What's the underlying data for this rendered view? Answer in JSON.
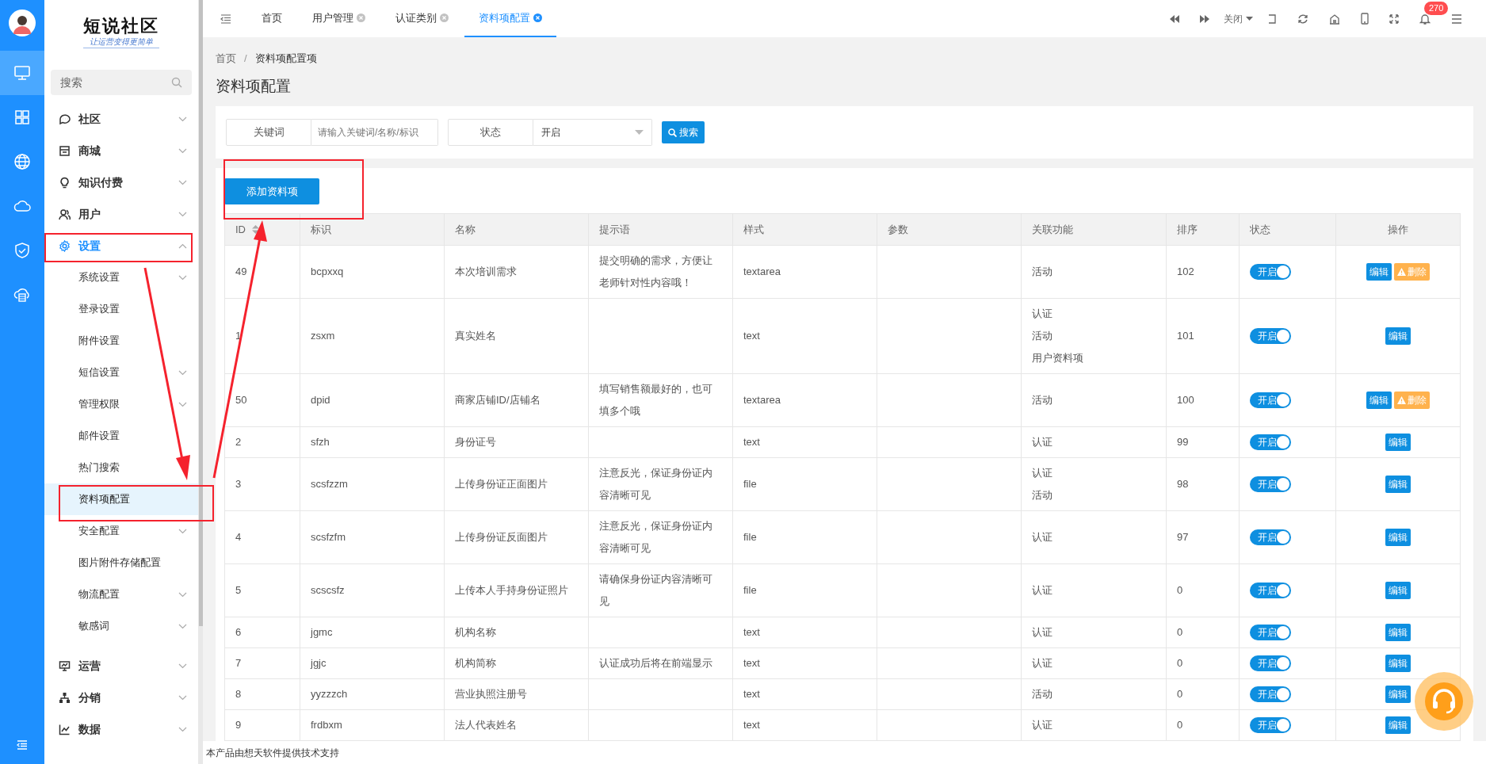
{
  "rail": {
    "items": [
      {
        "selected": true
      },
      {
        "selected": false
      },
      {
        "selected": false
      },
      {
        "selected": false
      },
      {
        "selected": false
      },
      {
        "selected": false
      }
    ]
  },
  "logo": {
    "title": "短说社区",
    "tagline": "让运营变得更简单"
  },
  "sidebar": {
    "search": {
      "placeholder": "搜索"
    },
    "items": [
      {
        "label": "社区",
        "expandable": true,
        "expanded": false,
        "selected": false
      },
      {
        "label": "商城",
        "expandable": true,
        "expanded": false,
        "selected": false
      },
      {
        "label": "知识付费",
        "expandable": true,
        "expanded": false,
        "selected": false
      },
      {
        "label": "用户",
        "expandable": true,
        "expanded": false,
        "selected": false
      },
      {
        "label": "设置",
        "expandable": true,
        "expanded": true,
        "selected": true,
        "children": [
          {
            "label": "系统设置",
            "expandable": true,
            "selected": false
          },
          {
            "label": "登录设置",
            "expandable": false,
            "selected": false
          },
          {
            "label": "附件设置",
            "expandable": false,
            "selected": false
          },
          {
            "label": "短信设置",
            "expandable": true,
            "selected": false
          },
          {
            "label": "管理权限",
            "expandable": true,
            "selected": false
          },
          {
            "label": "邮件设置",
            "expandable": false,
            "selected": false
          },
          {
            "label": "热门搜索",
            "expandable": false,
            "selected": false
          },
          {
            "label": "资料项配置",
            "expandable": false,
            "selected": true
          },
          {
            "label": "安全配置",
            "expandable": true,
            "selected": false
          },
          {
            "label": "图片附件存储配置",
            "expandable": false,
            "selected": false
          },
          {
            "label": "物流配置",
            "expandable": true,
            "selected": false
          },
          {
            "label": "敏感词",
            "expandable": true,
            "selected": false
          }
        ]
      },
      {
        "label": "运营",
        "expandable": true,
        "expanded": false,
        "selected": false
      },
      {
        "label": "分销",
        "expandable": true,
        "expanded": false,
        "selected": false
      },
      {
        "label": "数据",
        "expandable": true,
        "expanded": false,
        "selected": false
      }
    ]
  },
  "tabs": [
    {
      "label": "首页",
      "closable": false,
      "selected": false
    },
    {
      "label": "用户管理",
      "closable": true,
      "selected": false
    },
    {
      "label": "认证类别",
      "closable": true,
      "selected": false
    },
    {
      "label": "资料项配置",
      "closable": true,
      "selected": true
    }
  ],
  "toolbar": {
    "close_menu": "关闭",
    "notification_count": "270"
  },
  "breadcrumb": [
    "首页",
    "资料项配置项"
  ],
  "breadcrumb_separator": "/",
  "page_title": "资料项配置",
  "filters": [
    {
      "kind": "text",
      "label": "关键词",
      "placeholder": "请输入关键词/名称/标识"
    },
    {
      "kind": "select",
      "label": "状态",
      "value": "开启"
    }
  ],
  "search_button": "搜索",
  "add_button": "添加资料项",
  "table": {
    "columns": [
      {
        "label": "ID",
        "sortable": true
      },
      {
        "label": "标识",
        "sortable": false
      },
      {
        "label": "名称",
        "sortable": false
      },
      {
        "label": "提示语",
        "sortable": false
      },
      {
        "label": "样式",
        "sortable": false
      },
      {
        "label": "参数",
        "sortable": false
      },
      {
        "label": "关联功能",
        "sortable": false
      },
      {
        "label": "排序",
        "sortable": false
      },
      {
        "label": "状态",
        "sortable": false
      },
      {
        "label": "操作",
        "sortable": false
      }
    ],
    "rows": [
      {
        "id": "49",
        "key": "bcpxxq",
        "name": "本次培训需求",
        "hint": "提交明确的需求，方便让老师针对性内容哦！",
        "style": "textarea",
        "linked": [
          "活动"
        ],
        "sort": "102",
        "status": {
          "label": "开启",
          "on": true
        },
        "actions": [
          {
            "kind": "edit",
            "label": "编辑"
          },
          {
            "kind": "delete",
            "label": "删除"
          }
        ]
      },
      {
        "id": "1",
        "key": "zsxm",
        "name": "真实姓名",
        "style": "text",
        "linked": [
          "认证",
          "活动",
          "用户资料项"
        ],
        "sort": "101",
        "status": {
          "label": "开启",
          "on": true
        },
        "actions": [
          {
            "kind": "edit",
            "label": "编辑"
          }
        ]
      },
      {
        "id": "50",
        "key": "dpid",
        "name": "商家店铺ID/店铺名",
        "hint": "填写销售额最好的，也可填多个哦",
        "style": "textarea",
        "linked": [
          "活动"
        ],
        "sort": "100",
        "status": {
          "label": "开启",
          "on": true
        },
        "actions": [
          {
            "kind": "edit",
            "label": "编辑"
          },
          {
            "kind": "delete",
            "label": "删除"
          }
        ]
      },
      {
        "id": "2",
        "key": "sfzh",
        "name": "身份证号",
        "style": "text",
        "linked": [
          "认证"
        ],
        "sort": "99",
        "status": {
          "label": "开启",
          "on": true
        },
        "actions": [
          {
            "kind": "edit",
            "label": "编辑"
          }
        ]
      },
      {
        "id": "3",
        "key": "scsfzzm",
        "name": "上传身份证正面图片",
        "hint": "注意反光，保证身份证内容清晰可见",
        "style": "file",
        "linked": [
          "认证",
          "活动"
        ],
        "sort": "98",
        "status": {
          "label": "开启",
          "on": true
        },
        "actions": [
          {
            "kind": "edit",
            "label": "编辑"
          }
        ]
      },
      {
        "id": "4",
        "key": "scsfzfm",
        "name": "上传身份证反面图片",
        "hint": "注意反光，保证身份证内容清晰可见",
        "style": "file",
        "linked": [
          "认证"
        ],
        "sort": "97",
        "status": {
          "label": "开启",
          "on": true
        },
        "actions": [
          {
            "kind": "edit",
            "label": "编辑"
          }
        ]
      },
      {
        "id": "5",
        "key": "scscsfz",
        "name": "上传本人手持身份证照片",
        "hint": "请确保身份证内容清晰可见",
        "style": "file",
        "linked": [
          "认证"
        ],
        "sort": "0",
        "status": {
          "label": "开启",
          "on": true
        },
        "actions": [
          {
            "kind": "edit",
            "label": "编辑"
          }
        ]
      },
      {
        "id": "6",
        "key": "jgmc",
        "name": "机构名称",
        "style": "text",
        "linked": [
          "认证"
        ],
        "sort": "0",
        "status": {
          "label": "开启",
          "on": true
        },
        "actions": [
          {
            "kind": "edit",
            "label": "编辑"
          }
        ]
      },
      {
        "id": "7",
        "key": "jgjc",
        "name": "机构简称",
        "hint": "认证成功后将在前端显示",
        "style": "text",
        "linked": [
          "认证"
        ],
        "sort": "0",
        "status": {
          "label": "开启",
          "on": true
        },
        "actions": [
          {
            "kind": "edit",
            "label": "编辑"
          }
        ]
      },
      {
        "id": "8",
        "key": "yyzzzch",
        "name": "营业执照注册号",
        "style": "text",
        "linked": [
          "活动"
        ],
        "sort": "0",
        "status": {
          "label": "开启",
          "on": true
        },
        "actions": [
          {
            "kind": "edit",
            "label": "编辑"
          }
        ]
      },
      {
        "id": "9",
        "key": "frdbxm",
        "name": "法人代表姓名",
        "style": "text",
        "linked": [
          "认证"
        ],
        "sort": "0",
        "status": {
          "label": "开启",
          "on": true
        },
        "actions": [
          {
            "kind": "edit",
            "label": "编辑"
          }
        ]
      }
    ]
  },
  "footer": "本产品由想天软件提供技术支持"
}
